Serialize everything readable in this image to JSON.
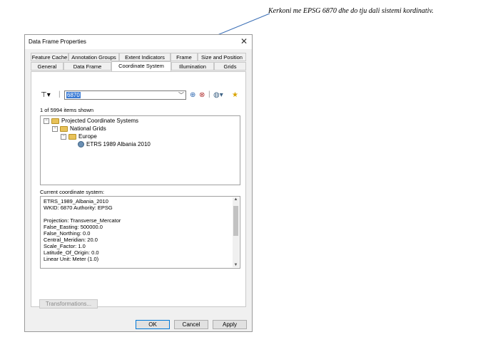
{
  "annotation": "Kerkoni me EPSG 6870 dhe do tju dali sistemi kordinativ.",
  "dialog": {
    "title": "Data Frame Properties",
    "close_glyph": "✕"
  },
  "tabs_row1": [
    {
      "label": "Feature Cache"
    },
    {
      "label": "Annotation Groups"
    },
    {
      "label": "Extent Indicators"
    },
    {
      "label": "Frame"
    },
    {
      "label": "Size and Position"
    }
  ],
  "tabs_row2": [
    {
      "label": "General"
    },
    {
      "label": "Data Frame"
    },
    {
      "label": "Coordinate System",
      "active": true
    },
    {
      "label": "Illumination"
    },
    {
      "label": "Grids"
    }
  ],
  "toolbar": {
    "filter_icon": "filter-icon",
    "search_value": "6870",
    "search_icon": "search-icon",
    "clear_icon": "clear-search-icon",
    "globe_icon": "globe-add-icon",
    "favorite_icon": "star-icon"
  },
  "count_text": "1 of 5994 items shown",
  "tree": {
    "nodes": [
      {
        "label": "Projected Coordinate Systems"
      },
      {
        "label": "National Grids"
      },
      {
        "label": "Europe"
      },
      {
        "label": "ETRS 1989 Albania 2010"
      }
    ]
  },
  "current": {
    "label": "Current coordinate system:",
    "lines": [
      "ETRS_1989_Albania_2010",
      "WKID: 6870 Authority: EPSG",
      "",
      "Projection: Transverse_Mercator",
      "False_Easting: 500000.0",
      "False_Northing: 0.0",
      "Central_Meridian: 20.0",
      "Scale_Factor: 1.0",
      "Latitude_Of_Origin: 0.0",
      "Linear Unit: Meter (1.0)"
    ]
  },
  "buttons": {
    "transformations": "Transformations...",
    "ok": "OK",
    "cancel": "Cancel",
    "apply": "Apply"
  },
  "colors": {
    "selection": "#3a7bd5",
    "arrow": "#3b6fb6"
  }
}
